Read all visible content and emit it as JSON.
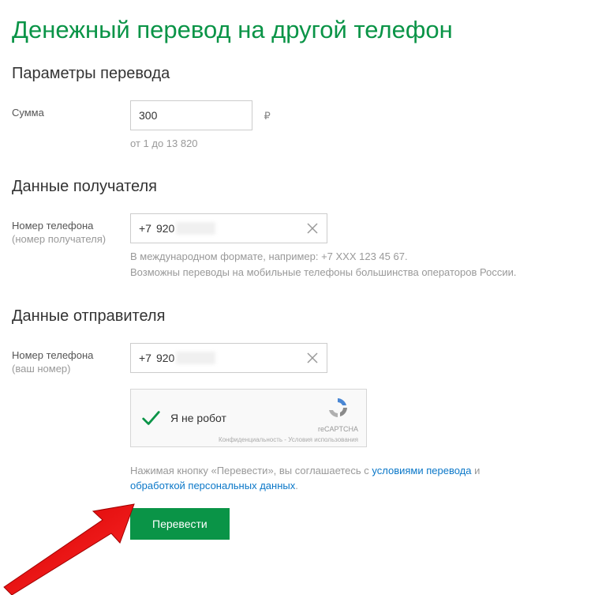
{
  "title": "Денежный перевод на другой телефон",
  "sections": {
    "params": {
      "heading": "Параметры перевода",
      "amount_label": "Сумма",
      "amount_value": "300",
      "currency": "₽",
      "amount_hint": "от 1 до 13 820"
    },
    "recipient": {
      "heading": "Данные получателя",
      "phone_label": "Номер телефона",
      "phone_sublabel": "(номер получателя)",
      "phone_prefix": "+7",
      "phone_value": "920",
      "hint1": "В международном формате, например: +7 XXX 123 45 67.",
      "hint2": "Возможны переводы на мобильные телефоны большинства операторов России."
    },
    "sender": {
      "heading": "Данные отправителя",
      "phone_label": "Номер телефона",
      "phone_sublabel": "(ваш номер)",
      "phone_prefix": "+7",
      "phone_value": "920"
    }
  },
  "captcha": {
    "label": "Я не робот",
    "brand": "reCAPTCHA",
    "legal": "Конфиденциальность - Условия использования"
  },
  "consent": {
    "pre": "Нажимая кнопку «Перевести», вы соглашаетесь с ",
    "link1": "условиями перевода",
    "mid": " и ",
    "link2": "обработкой персональных данных",
    "post": "."
  },
  "submit_label": "Перевести"
}
